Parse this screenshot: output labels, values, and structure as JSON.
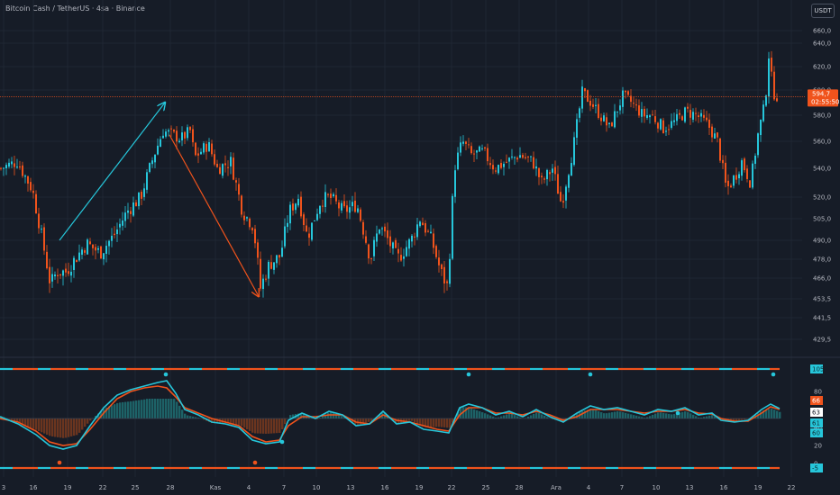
{
  "header": {
    "title": "Bitcoin Cash / TetherUS · 4sa · Binance",
    "currency": "USDT"
  },
  "colors": {
    "background": "#161c27",
    "up": "#26c6da",
    "down": "#f0531c",
    "grid": "#1f2633",
    "price_line": "#f0531c",
    "osc_teal": "#26c6da",
    "osc_orange": "#f0531c",
    "hist_teal": "#1e6f73",
    "hist_orange": "#7a3a1e"
  },
  "price_axis": {
    "ticks": [
      "660,0",
      "640,0",
      "620,0",
      "600,0",
      "580,0",
      "560,0",
      "540,0",
      "520,0",
      "505,0",
      "490,0",
      "478,0",
      "466,0",
      "453,5",
      "441,5",
      "429,5"
    ],
    "last_price": "594,7",
    "countdown": "02:55:50"
  },
  "osc_axis": {
    "ticks": [
      "80",
      "40",
      "20",
      "0"
    ],
    "tags": [
      {
        "text": "105",
        "color": "#26c6da",
        "text_color": "#0d2a30"
      },
      {
        "text": "66",
        "color": "#f0531c",
        "text_color": "#ffffff"
      },
      {
        "text": "63",
        "color": "#ffffff",
        "text_color": "#161c27"
      },
      {
        "text": "61",
        "color": "#26c6da",
        "text_color": "#0d2a30"
      },
      {
        "text": "60",
        "color": "#26c6da",
        "text_color": "#0d2a30"
      },
      {
        "text": "-5",
        "color": "#26c6da",
        "text_color": "#0d2a30"
      }
    ]
  },
  "time_axis": [
    "3",
    "16",
    "19",
    "22",
    "25",
    "28",
    "Kas",
    "4",
    "7",
    "10",
    "13",
    "16",
    "19",
    "22",
    "25",
    "28",
    "Ara",
    "4",
    "7",
    "10",
    "13",
    "16",
    "19",
    "22"
  ],
  "chart_data": {
    "type": "candlestick",
    "symbol": "Bitcoin Cash / TetherUS",
    "interval": "4sa",
    "exchange": "Binance",
    "last_price": 594.7,
    "ylim": [
      420,
      665
    ],
    "price_ticks": [
      660,
      640,
      620,
      600,
      580,
      560,
      540,
      520,
      505,
      490,
      478,
      466,
      453.5,
      441.5,
      429.5
    ],
    "anchors": [
      [
        0,
        540
      ],
      [
        18,
        545
      ],
      [
        35,
        525
      ],
      [
        55,
        462
      ],
      [
        62,
        470
      ],
      [
        72,
        470
      ],
      [
        82,
        478
      ],
      [
        95,
        488
      ],
      [
        110,
        482
      ],
      [
        125,
        493
      ],
      [
        140,
        510
      ],
      [
        155,
        520
      ],
      [
        170,
        550
      ],
      [
        180,
        568
      ],
      [
        190,
        565
      ],
      [
        200,
        562
      ],
      [
        210,
        568
      ],
      [
        215,
        548
      ],
      [
        230,
        558
      ],
      [
        240,
        540
      ],
      [
        255,
        545
      ],
      [
        268,
        510
      ],
      [
        280,
        500
      ],
      [
        288,
        460
      ],
      [
        298,
        475
      ],
      [
        310,
        480
      ],
      [
        320,
        510
      ],
      [
        330,
        520
      ],
      [
        340,
        492
      ],
      [
        355,
        518
      ],
      [
        365,
        520
      ],
      [
        380,
        510
      ],
      [
        395,
        515
      ],
      [
        405,
        490
      ],
      [
        410,
        478
      ],
      [
        420,
        500
      ],
      [
        428,
        492
      ],
      [
        440,
        478
      ],
      [
        455,
        490
      ],
      [
        465,
        505
      ],
      [
        478,
        490
      ],
      [
        488,
        470
      ],
      [
        496,
        460
      ],
      [
        503,
        540
      ],
      [
        512,
        560
      ],
      [
        522,
        550
      ],
      [
        535,
        552
      ],
      [
        548,
        540
      ],
      [
        562,
        545
      ],
      [
        575,
        550
      ],
      [
        590,
        545
      ],
      [
        600,
        530
      ],
      [
        612,
        540
      ],
      [
        622,
        515
      ],
      [
        635,
        555
      ],
      [
        645,
        598
      ],
      [
        655,
        590
      ],
      [
        665,
        580
      ],
      [
        675,
        570
      ],
      [
        690,
        595
      ],
      [
        700,
        590
      ],
      [
        712,
        580
      ],
      [
        722,
        580
      ],
      [
        735,
        570
      ],
      [
        748,
        575
      ],
      [
        760,
        583
      ],
      [
        772,
        580
      ],
      [
        785,
        572
      ],
      [
        795,
        560
      ],
      [
        805,
        525
      ],
      [
        815,
        535
      ],
      [
        822,
        545
      ],
      [
        832,
        530
      ],
      [
        840,
        565
      ],
      [
        848,
        590
      ],
      [
        852,
        630
      ],
      [
        857,
        598
      ],
      [
        862,
        594.7
      ]
    ],
    "annotations": [
      {
        "type": "arrow",
        "direction": "up",
        "from_price": 490,
        "to_price": 590
      },
      {
        "type": "arrow",
        "direction": "down",
        "from_price": 565,
        "to_price": 455
      }
    ],
    "oscillator": {
      "range": [
        -10,
        110
      ],
      "ticks": [
        80,
        40,
        20,
        0
      ],
      "upper_band": 105,
      "lower_band": -5,
      "midline": 50,
      "last_values": [
        66,
        63,
        61,
        60
      ],
      "teal_line": [
        [
          0,
          52
        ],
        [
          20,
          44
        ],
        [
          40,
          32
        ],
        [
          55,
          20
        ],
        [
          70,
          16
        ],
        [
          85,
          20
        ],
        [
          100,
          42
        ],
        [
          115,
          62
        ],
        [
          130,
          76
        ],
        [
          145,
          82
        ],
        [
          160,
          86
        ],
        [
          175,
          90
        ],
        [
          185,
          92
        ],
        [
          195,
          78
        ],
        [
          205,
          60
        ],
        [
          220,
          54
        ],
        [
          235,
          46
        ],
        [
          250,
          44
        ],
        [
          265,
          40
        ],
        [
          280,
          26
        ],
        [
          295,
          22
        ],
        [
          310,
          24
        ],
        [
          320,
          48
        ],
        [
          335,
          56
        ],
        [
          350,
          50
        ],
        [
          365,
          58
        ],
        [
          380,
          54
        ],
        [
          395,
          42
        ],
        [
          410,
          44
        ],
        [
          425,
          58
        ],
        [
          440,
          44
        ],
        [
          455,
          46
        ],
        [
          470,
          38
        ],
        [
          485,
          36
        ],
        [
          498,
          34
        ],
        [
          510,
          62
        ],
        [
          520,
          66
        ],
        [
          535,
          62
        ],
        [
          550,
          54
        ],
        [
          565,
          58
        ],
        [
          580,
          52
        ],
        [
          595,
          60
        ],
        [
          610,
          52
        ],
        [
          625,
          46
        ],
        [
          640,
          56
        ],
        [
          655,
          64
        ],
        [
          670,
          60
        ],
        [
          685,
          62
        ],
        [
          700,
          58
        ],
        [
          715,
          54
        ],
        [
          730,
          60
        ],
        [
          745,
          58
        ],
        [
          760,
          62
        ],
        [
          775,
          54
        ],
        [
          790,
          56
        ],
        [
          800,
          48
        ],
        [
          815,
          46
        ],
        [
          830,
          48
        ],
        [
          845,
          60
        ],
        [
          855,
          66
        ],
        [
          865,
          61
        ]
      ],
      "orange_line": [
        [
          0,
          50
        ],
        [
          20,
          46
        ],
        [
          40,
          36
        ],
        [
          55,
          24
        ],
        [
          70,
          20
        ],
        [
          85,
          22
        ],
        [
          100,
          38
        ],
        [
          115,
          56
        ],
        [
          130,
          72
        ],
        [
          145,
          80
        ],
        [
          160,
          84
        ],
        [
          175,
          86
        ],
        [
          185,
          84
        ],
        [
          195,
          74
        ],
        [
          205,
          62
        ],
        [
          220,
          56
        ],
        [
          235,
          50
        ],
        [
          250,
          46
        ],
        [
          265,
          42
        ],
        [
          280,
          30
        ],
        [
          295,
          24
        ],
        [
          310,
          26
        ],
        [
          320,
          42
        ],
        [
          335,
          52
        ],
        [
          350,
          52
        ],
        [
          365,
          54
        ],
        [
          380,
          54
        ],
        [
          395,
          46
        ],
        [
          410,
          44
        ],
        [
          425,
          54
        ],
        [
          440,
          48
        ],
        [
          455,
          46
        ],
        [
          470,
          42
        ],
        [
          485,
          38
        ],
        [
          498,
          36
        ],
        [
          510,
          54
        ],
        [
          520,
          62
        ],
        [
          535,
          62
        ],
        [
          550,
          56
        ],
        [
          565,
          56
        ],
        [
          580,
          54
        ],
        [
          595,
          58
        ],
        [
          610,
          54
        ],
        [
          625,
          48
        ],
        [
          640,
          52
        ],
        [
          655,
          60
        ],
        [
          670,
          60
        ],
        [
          685,
          60
        ],
        [
          700,
          58
        ],
        [
          715,
          56
        ],
        [
          730,
          58
        ],
        [
          745,
          58
        ],
        [
          760,
          60
        ],
        [
          775,
          56
        ],
        [
          790,
          55
        ],
        [
          800,
          50
        ],
        [
          815,
          47
        ],
        [
          830,
          47
        ],
        [
          845,
          56
        ],
        [
          855,
          63
        ],
        [
          865,
          60
        ]
      ],
      "top_dots": [
        184,
        520,
        655,
        858
      ],
      "bottom_dots": [
        66,
        283
      ],
      "line_dots": [
        [
          313,
          24
        ],
        [
          752,
          56
        ]
      ]
    }
  }
}
